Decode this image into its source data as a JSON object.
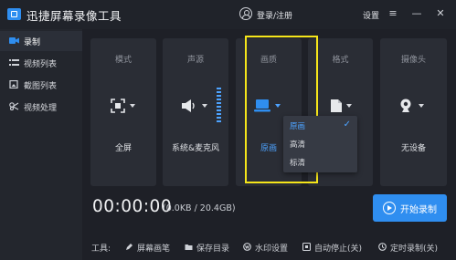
{
  "app": {
    "title": "迅捷屏幕录像工具",
    "login_label": "登录/注册",
    "settings_label": "设置",
    "menu_symbol": "≡",
    "minimize_symbol": "—",
    "close_symbol": "✕"
  },
  "sidebar": {
    "items": [
      {
        "label": "录制",
        "icon": "record-icon",
        "active": true
      },
      {
        "label": "视频列表",
        "icon": "video-list-icon",
        "active": false
      },
      {
        "label": "截图列表",
        "icon": "screenshot-list-icon",
        "active": false
      },
      {
        "label": "视频处理",
        "icon": "video-process-icon",
        "active": false
      }
    ]
  },
  "cards": [
    {
      "title": "模式",
      "value": "全屏",
      "icon": "fullscreen-icon"
    },
    {
      "title": "声源",
      "value": "系统&麦克风",
      "icon": "speaker-icon"
    },
    {
      "title": "画质",
      "value": "原画",
      "icon": "monitor-icon"
    },
    {
      "title": "格式",
      "value": "",
      "icon": "file-format-icon"
    },
    {
      "title": "摄像头",
      "value": "无设备",
      "icon": "camera-icon"
    }
  ],
  "quality_dropdown": {
    "options": [
      {
        "label": "原画",
        "selected": true
      },
      {
        "label": "高清",
        "selected": false
      },
      {
        "label": "标清",
        "selected": false
      }
    ],
    "check_symbol": "✓"
  },
  "recording": {
    "timer": "00:00:00",
    "size_info": "(0.0KB / 20.4GB)",
    "start_label": "开始录制"
  },
  "tools": {
    "label": "工具:",
    "items": [
      {
        "label": "屏幕画笔",
        "icon": "brush-icon"
      },
      {
        "label": "保存目录",
        "icon": "folder-icon"
      },
      {
        "label": "水印设置",
        "icon": "watermark-icon"
      },
      {
        "label": "自动停止(关)",
        "icon": "auto-stop-icon"
      },
      {
        "label": "定时录制(关)",
        "icon": "timer-icon"
      }
    ]
  },
  "colors": {
    "accent": "#2f8ef0",
    "highlight_box": "#f5e51a",
    "selected_text": "#4da3ff",
    "background": "#1e2027",
    "card": "#2a2d35"
  }
}
